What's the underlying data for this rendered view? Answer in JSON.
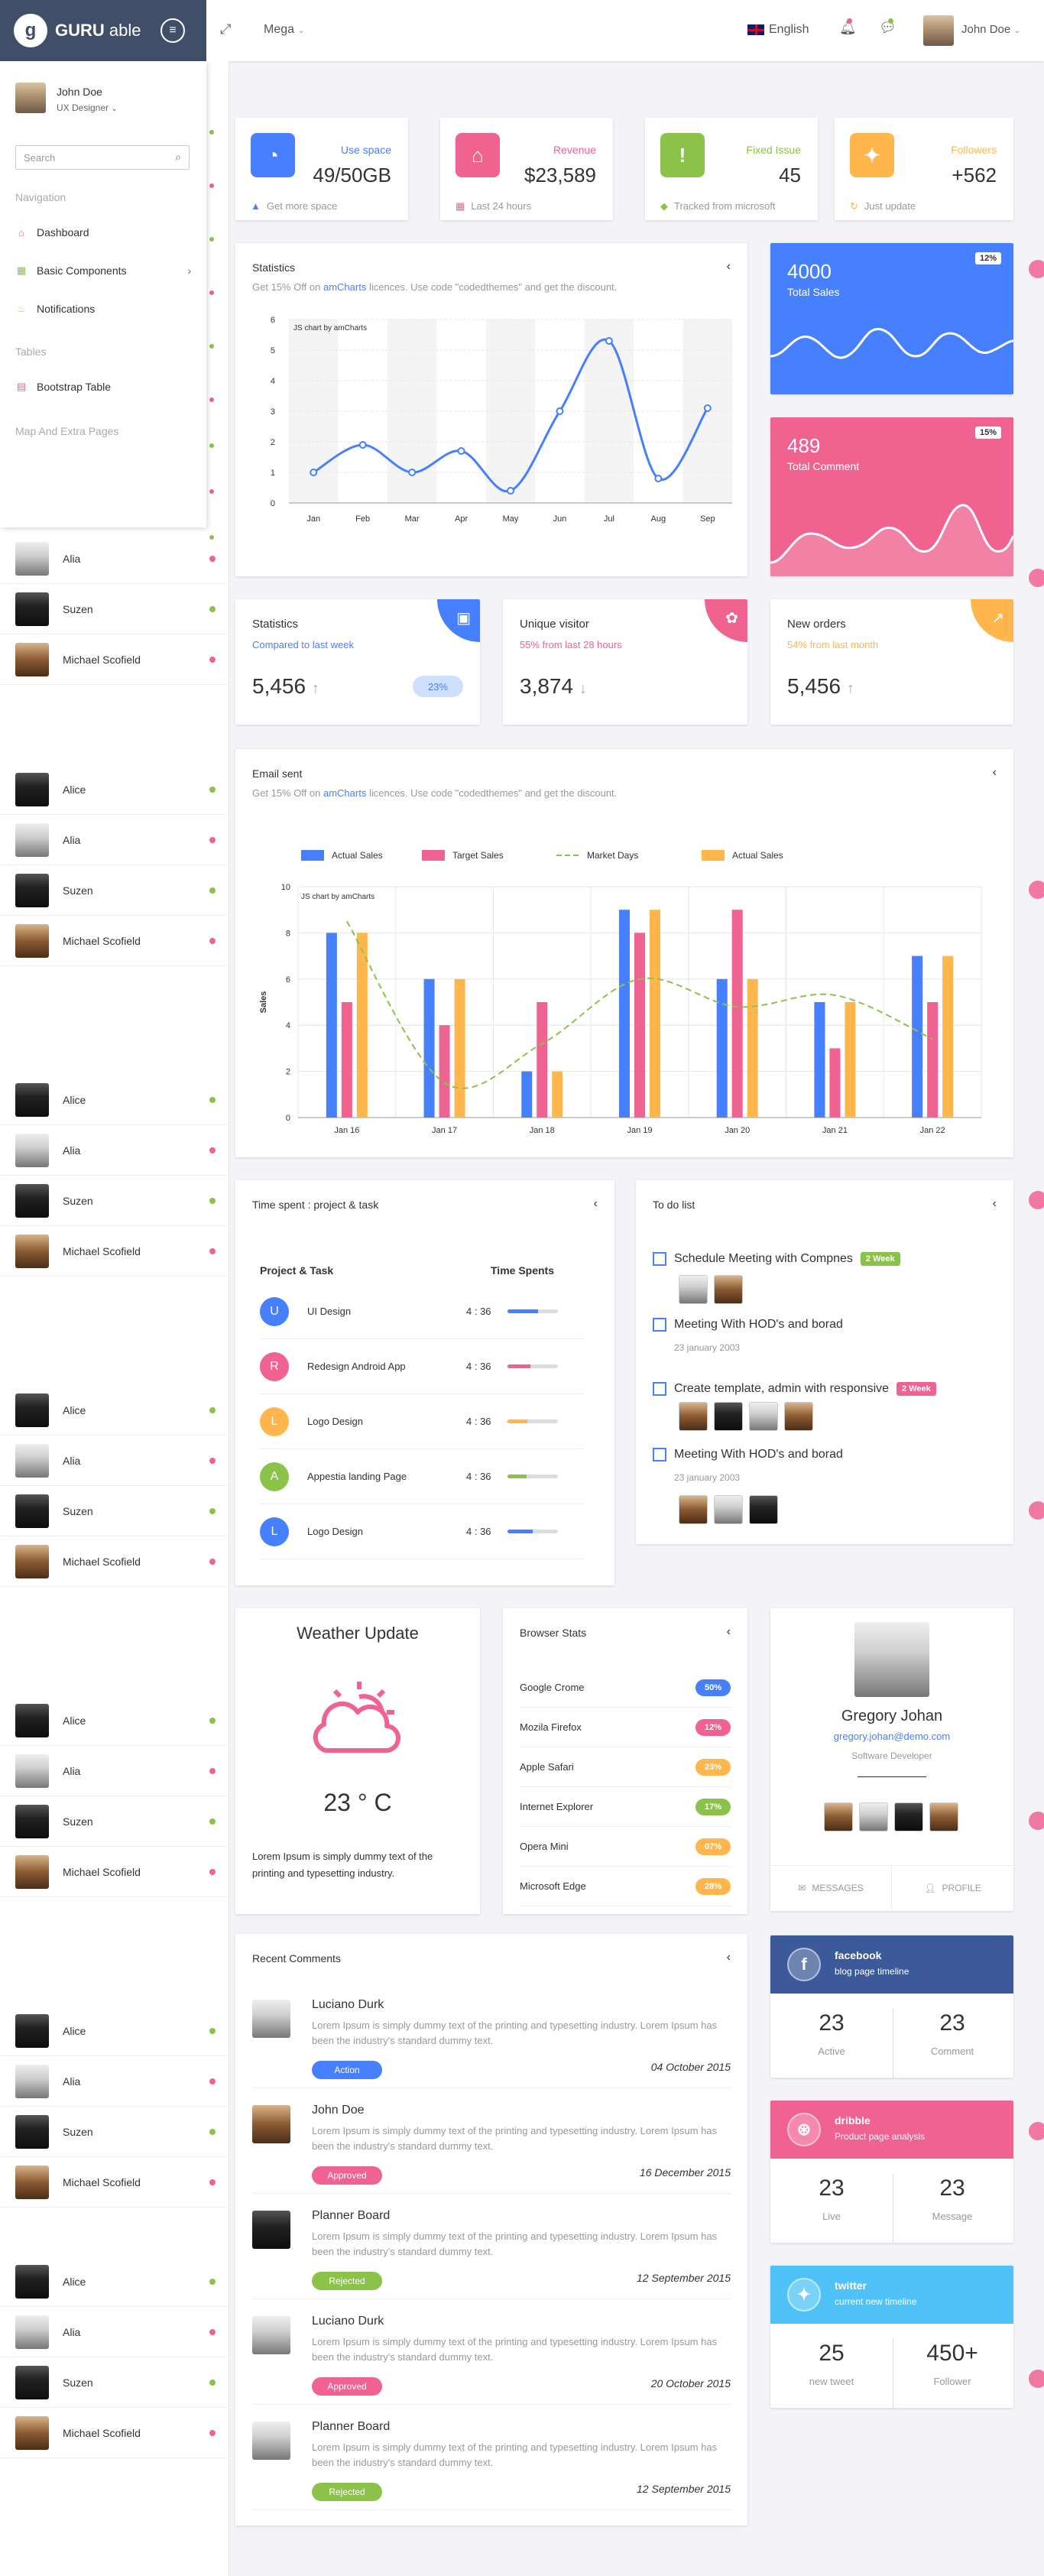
{
  "topbar": {
    "brand_bold": "GURU",
    "brand_light": " able",
    "mega": "Mega",
    "language": "English",
    "user": "John Doe"
  },
  "sidebar": {
    "user_name": "John Doe",
    "user_role": "UX Designer",
    "search_placeholder": "Search",
    "section_navigation": "Navigation",
    "items": [
      {
        "label": "Dashboard"
      },
      {
        "label": "Basic Components"
      },
      {
        "label": "Notifications"
      }
    ],
    "section_tables": "Tables",
    "table_item": "Bootstrap Table",
    "section_extra": "Map And Extra Pages"
  },
  "chat_names": [
    "Alice",
    "Alia",
    "Suzen",
    "Michael Scofield"
  ],
  "stats": [
    {
      "label": "Use space",
      "value": "49/50GB",
      "foot": "Get more space",
      "color": "#4680ff"
    },
    {
      "label": "Revenue",
      "value": "$23,589",
      "foot": "Last 24 hours",
      "color": "#f06290"
    },
    {
      "label": "Fixed Issue",
      "value": "45",
      "foot": "Tracked from microsoft",
      "color": "#8bc34a"
    },
    {
      "label": "Followers",
      "value": "+562",
      "foot": "Just update",
      "color": "#ffb64d"
    }
  ],
  "statistics_chart": {
    "title": "Statistics",
    "sub_prefix": "Get 15% Off on ",
    "sub_link": "amCharts",
    "sub_suffix": " licences. Use code \"codedthemes\" and get the discount.",
    "watermark": "JS chart by amCharts"
  },
  "email_chart": {
    "title": "Email sent",
    "sub_prefix": "Get 15% Off on ",
    "sub_link": "amCharts",
    "sub_suffix": " licences. Use code \"codedthemes\" and get the discount.",
    "watermark": "JS chart by amCharts",
    "ylabel": "Sales"
  },
  "chart_data": [
    {
      "type": "line",
      "title": "Statistics",
      "categories": [
        "Jan",
        "Feb",
        "Mar",
        "Apr",
        "May",
        "Jun",
        "Jul",
        "Aug",
        "Sep"
      ],
      "values": [
        1,
        1.9,
        1,
        1.7,
        0.4,
        3,
        5.3,
        0.8,
        3.1
      ],
      "ylim": [
        0,
        6
      ],
      "yticks": [
        0,
        1,
        2,
        3,
        4,
        5,
        6
      ],
      "grid": true
    },
    {
      "type": "bar",
      "title": "Email sent",
      "ylabel": "Sales",
      "categories": [
        "Jan 16",
        "Jan 17",
        "Jan 18",
        "Jan 19",
        "Jan 20",
        "Jan 21",
        "Jan 22"
      ],
      "series": [
        {
          "name": "Actual Sales",
          "values": [
            8,
            6,
            2,
            9,
            6,
            5,
            7
          ],
          "color": "#4680ff"
        },
        {
          "name": "Target Sales",
          "values": [
            5,
            4,
            5,
            8,
            9,
            3,
            5
          ],
          "color": "#f06290"
        },
        {
          "name": "Market Days",
          "type": "line",
          "values": [
            8.5,
            1.5,
            3.2,
            6,
            4.8,
            5.3,
            3.4
          ],
          "color": "#8bc34a"
        },
        {
          "name": "Actual Sales",
          "values": [
            8,
            6,
            2,
            9,
            6,
            5,
            7
          ],
          "color": "#ffb64d"
        }
      ],
      "ylim": [
        0,
        10
      ],
      "yticks": [
        0,
        2,
        4,
        6,
        8,
        10
      ],
      "legend": "top",
      "grid": true
    }
  ],
  "color_cards": [
    {
      "num": "4000",
      "label": "Total Sales",
      "badge": "12%"
    },
    {
      "num": "489",
      "label": "Total Comment",
      "badge": "15%"
    }
  ],
  "small_stats": [
    {
      "title": "Statistics",
      "sub": "Compared to last week",
      "value": "5,456",
      "arrow": "↑",
      "badge": "23%"
    },
    {
      "title": "Unique visitor",
      "sub": "55% from last 28 hours",
      "value": "3,874",
      "arrow": "↓"
    },
    {
      "title": "New orders",
      "sub": "54% from last month",
      "value": "5,456",
      "arrow": "↑"
    }
  ],
  "time_spent": {
    "title": "Time spent : project & task",
    "col1": "Project & Task",
    "col2": "Time Spents",
    "rows": [
      {
        "letter": "U",
        "name": "UI Design",
        "time": "4 : 36",
        "progress": 0.6
      },
      {
        "letter": "R",
        "name": "Redesign Android App",
        "time": "4 : 36",
        "progress": 0.45
      },
      {
        "letter": "L",
        "name": "Logo Design",
        "time": "4 : 36",
        "progress": 0.4
      },
      {
        "letter": "A",
        "name": "Appestia landing Page",
        "time": "4 : 36",
        "progress": 0.38
      },
      {
        "letter": "L",
        "name": "Logo Design",
        "time": "4 : 36",
        "progress": 0.5
      }
    ]
  },
  "todo": {
    "title": "To do list",
    "items": [
      {
        "text": "Schedule Meeting with Compnes",
        "badge": "2 Week"
      },
      {
        "text": "Meeting With HOD's and borad",
        "date": "23 january 2003"
      },
      {
        "text": "Create template, admin with responsive",
        "badge": "2 Week"
      },
      {
        "text": "Meeting With HOD's and borad",
        "date": "23 january 2003"
      }
    ]
  },
  "weather": {
    "title": "Weather Update",
    "temp": "23 ° C",
    "text": "Lorem Ipsum is simply dummy text of the printing and typesetting industry."
  },
  "browser_stats": {
    "title": "Browser Stats",
    "rows": [
      {
        "name": "Google Crome",
        "value": "50%"
      },
      {
        "name": "Mozila Firefox",
        "value": "12%"
      },
      {
        "name": "Apple Safari",
        "value": "23%"
      },
      {
        "name": "Internet Explorer",
        "value": "17%"
      },
      {
        "name": "Opera Mini",
        "value": "07%"
      },
      {
        "name": "Microsoft Edge",
        "value": "28%"
      }
    ]
  },
  "profile": {
    "name": "Gregory Johan",
    "email": "gregory.johan@demo.com",
    "role": "Software Developer",
    "messages": "MESSAGES",
    "profile_btn": "PROFILE"
  },
  "comments": {
    "title": "Recent Comments",
    "body": "Lorem Ipsum is simply dummy text of the printing and typesetting industry. Lorem Ipsum has been the industry's standard dummy text.",
    "rows": [
      {
        "name": "Luciano Durk",
        "btn": "Action",
        "date": "04 October 2015"
      },
      {
        "name": "John Doe",
        "btn": "Approved",
        "date": "16 December 2015"
      },
      {
        "name": "Planner Board",
        "btn": "Rejected",
        "date": "12 September 2015"
      },
      {
        "name": "Luciano Durk",
        "btn": "Approved",
        "date": "20 October 2015"
      },
      {
        "name": "Planner Board",
        "btn": "Rejected",
        "date": "12 September 2015"
      }
    ]
  },
  "social": [
    {
      "name": "facebook",
      "desc": "blog page timeline",
      "n1": "23",
      "l1": "Active",
      "n2": "23",
      "l2": "Comment"
    },
    {
      "name": "dribble",
      "desc": "Product page analysis",
      "n1": "23",
      "l1": "Live",
      "n2": "23",
      "l2": "Message"
    },
    {
      "name": "twitter",
      "desc": "current new timeline",
      "n1": "25",
      "l1": "new tweet",
      "n2": "450+",
      "l2": "Follower"
    }
  ]
}
